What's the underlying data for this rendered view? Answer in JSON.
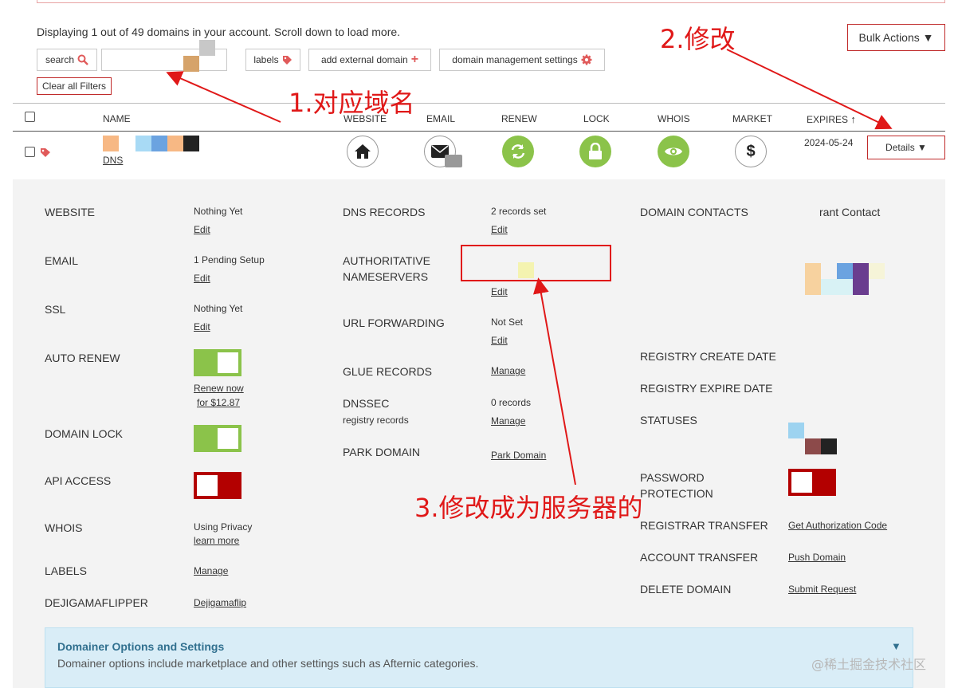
{
  "header": {
    "display_text": "Displaying 1 out of 49 domains in your account. Scroll down to load more.",
    "bulk_actions": "Bulk Actions ▼"
  },
  "toolbar": {
    "search_label": "search",
    "labels_label": "labels",
    "add_external_label": "add external domain",
    "dms_label": "domain management settings",
    "clear_filters": "Clear all Filters"
  },
  "table": {
    "columns": [
      "NAME",
      "WEBSITE",
      "EMAIL",
      "RENEW",
      "LOCK",
      "WHOIS",
      "MARKET",
      "EXPIRES"
    ],
    "row": {
      "dns_link": "DNS",
      "expires": "2024-05-24",
      "details": "Details ▼"
    }
  },
  "details": {
    "col1": [
      {
        "label": "WEBSITE",
        "value": "Nothing Yet",
        "link": "Edit"
      },
      {
        "label": "EMAIL",
        "value": "1 Pending Setup",
        "link": "Edit"
      },
      {
        "label": "SSL",
        "value": "Nothing Yet",
        "link": "Edit"
      },
      {
        "label": "AUTO RENEW",
        "link1": "Renew now",
        "link2": "for $12.87",
        "toggle": "on"
      },
      {
        "label": "DOMAIN LOCK",
        "toggle": "on"
      },
      {
        "label": "API ACCESS",
        "toggle": "off"
      },
      {
        "label": "WHOIS",
        "value": "Using Privacy",
        "link": "learn more"
      },
      {
        "label": "LABELS",
        "link": "Manage"
      },
      {
        "label": "DEJIGAMAFLIPPER",
        "link": "Dejigamaflip"
      }
    ],
    "col2": [
      {
        "label": "DNS RECORDS",
        "value": "2 records set",
        "link": "Edit"
      },
      {
        "label": "AUTHORITATIVE",
        "label2": "NAMESERVERS",
        "link": "Edit"
      },
      {
        "label": "URL FORWARDING",
        "value": "Not Set",
        "link": "Edit"
      },
      {
        "label": "GLUE RECORDS",
        "link": "Manage"
      },
      {
        "label": "DNSSEC",
        "sub": "registry records",
        "value": "0 records",
        "link": "Manage"
      },
      {
        "label": "PARK DOMAIN",
        "link": "Park Domain"
      }
    ],
    "col3": [
      {
        "label": "DOMAIN CONTACTS",
        "value": "rant Contact"
      },
      {
        "label": "REGISTRY CREATE DATE"
      },
      {
        "label": "REGISTRY EXPIRE DATE"
      },
      {
        "label": "STATUSES"
      },
      {
        "label": "PASSWORD",
        "label2": "PROTECTION",
        "toggle": "off"
      },
      {
        "label": "REGISTRAR TRANSFER",
        "link": "Get Authorization Code"
      },
      {
        "label": "ACCOUNT TRANSFER",
        "link": "Push Domain"
      },
      {
        "label": "DELETE DOMAIN",
        "link": "Submit Request"
      }
    ]
  },
  "domainer": {
    "title": "Domainer Options and Settings",
    "desc": "Domainer options include marketplace and other settings such as Afternic categories.",
    "arrow": "▼"
  },
  "annotations": {
    "a1": "1.对应域名",
    "a2": "2.修改",
    "a3": "3.修改成为服务器的"
  },
  "watermark": "@稀土掘金技术社区",
  "colors": {
    "accent_red": "#c02a2a",
    "annotation_red": "#e01818",
    "toggle_green": "#8bc34a",
    "toggle_red": "#b30000",
    "panel_bg": "#f3f3f3",
    "info_bg": "#d9edf7"
  },
  "icons": {
    "website": "home-icon",
    "email": "envelope-icon",
    "renew": "refresh-icon",
    "lock": "lock-icon",
    "whois": "eye-icon",
    "market": "dollar-icon"
  }
}
